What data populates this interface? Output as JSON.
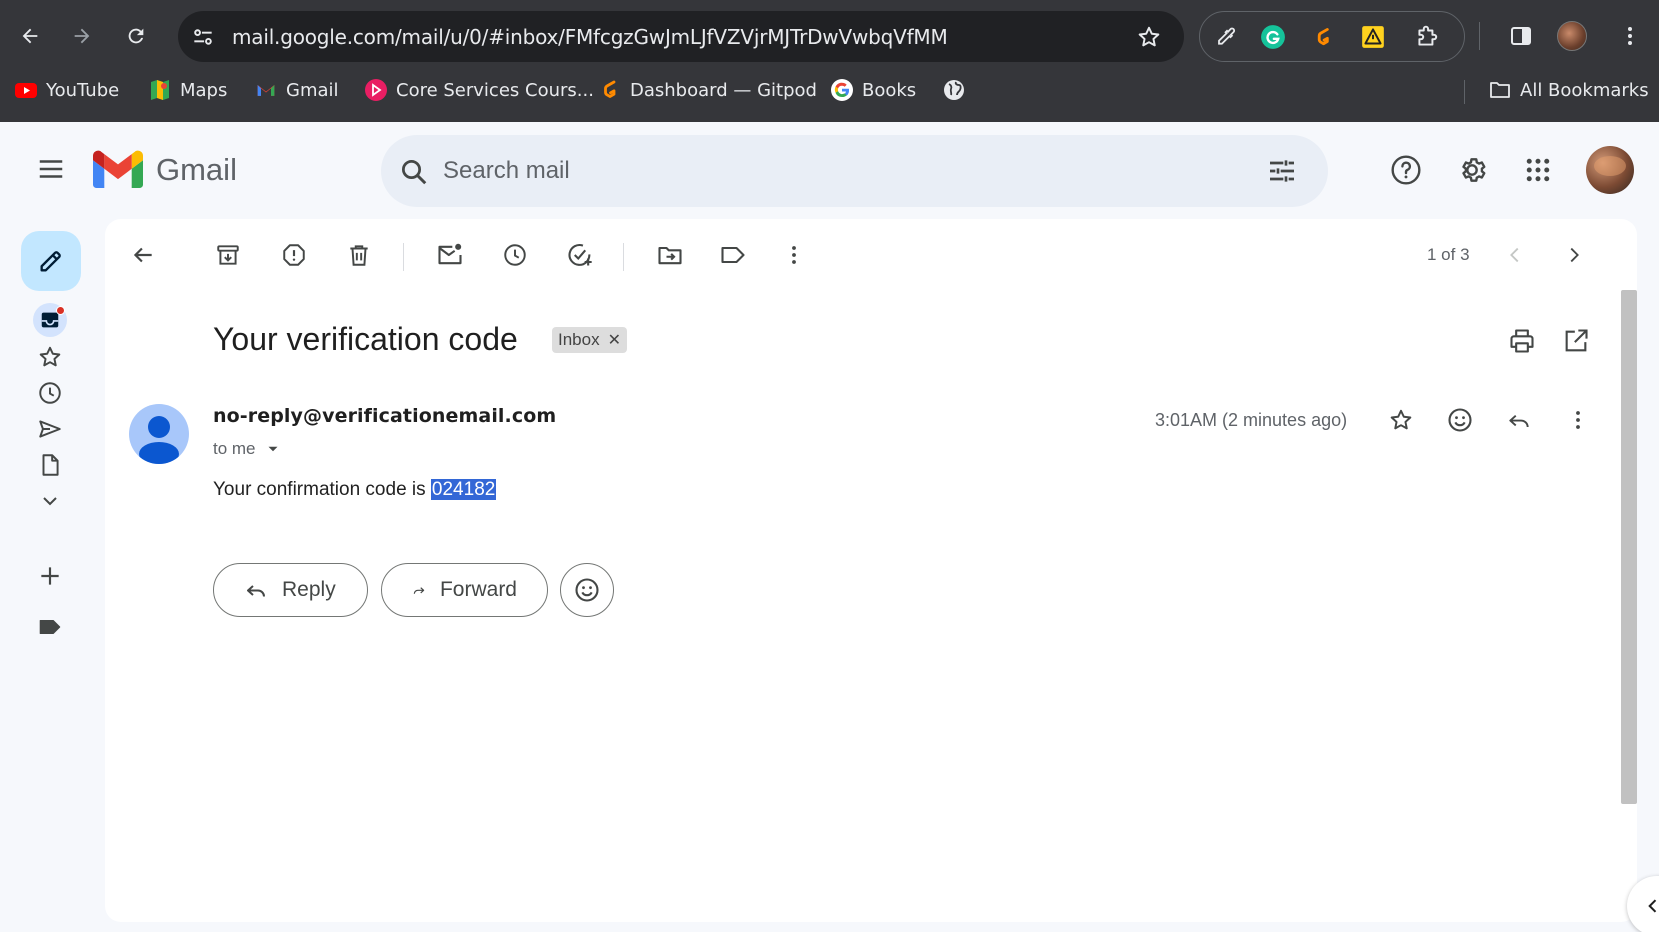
{
  "browser": {
    "url": "mail.google.com/mail/u/0/#inbox/FMfcgzGwJmLJfVZVjrMJTrDwVwbqVfMM",
    "bookmarks": [
      {
        "label": "YouTube",
        "icon": "youtube-icon"
      },
      {
        "label": "Maps",
        "icon": "maps-icon"
      },
      {
        "label": "Gmail",
        "icon": "gmail-icon"
      },
      {
        "label": "Core Services Cours...",
        "icon": "core-services-icon"
      },
      {
        "label": "Dashboard — Gitpod",
        "icon": "gitpod-icon"
      },
      {
        "label": "Books",
        "icon": "google-icon"
      },
      {
        "label": "",
        "icon": "globe-icon"
      }
    ],
    "all_bookmarks_label": "All Bookmarks"
  },
  "gmail": {
    "logo_text": "Gmail",
    "search_placeholder": "Search mail",
    "pager": "1 of 3",
    "email": {
      "subject": "Your verification code",
      "label": "Inbox",
      "sender": "no-reply@verificationemail.com",
      "recipient": "to me",
      "timestamp": "3:01AM (2 minutes ago)",
      "body_prefix": "Your confirmation code is ",
      "code": "024182"
    },
    "actions": {
      "reply": "Reply",
      "forward": "Forward"
    }
  },
  "colors": {
    "accent": "#0b57d0",
    "compose_bg": "#c2e7ff",
    "selection": "#3367d6",
    "chrome_bg": "#35363a"
  }
}
